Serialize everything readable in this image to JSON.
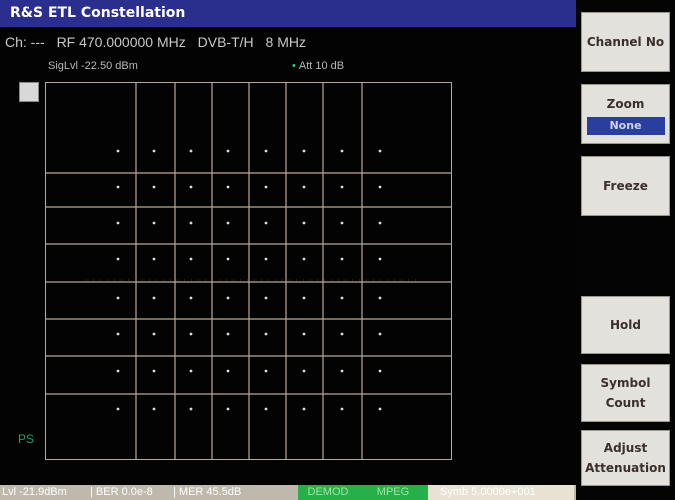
{
  "window": {
    "title": "R&S ETL Constellation"
  },
  "channel_line": {
    "ch": "Ch: ---",
    "rf": "RF 470.000000 MHz",
    "standard": "DVB-T/H",
    "bandwidth": "8 MHz"
  },
  "signal": {
    "siglvl": "SigLvl -22.50 dBm",
    "att": "Att 10 dB"
  },
  "plot": {
    "ps_label": "PS",
    "grid_columns": 8,
    "grid_rows": 8
  },
  "softkeys": {
    "channel_no": "Channel No",
    "zoom": "Zoom",
    "zoom_value": "None",
    "freeze": "Freeze",
    "hold": "Hold",
    "symbol_count": "Symbol Count",
    "adjust_attenuation": "Adjust Attenuation"
  },
  "status": {
    "lvl": "Lvl -21.9dBm",
    "ber": "| BER 0.0e-8",
    "mer": "| MER 45.5dB",
    "demod": "DEMOD",
    "mpeg": "MPEG",
    "symb": "Symb 5.0000e+001"
  },
  "colors": {
    "title_bar": "#2a2f8e",
    "grid_line": "#b8a79a",
    "status_green": "#27b04a",
    "softkey_bg": "#e3e1dc",
    "zoom_value_bg": "#2a3ea0"
  }
}
